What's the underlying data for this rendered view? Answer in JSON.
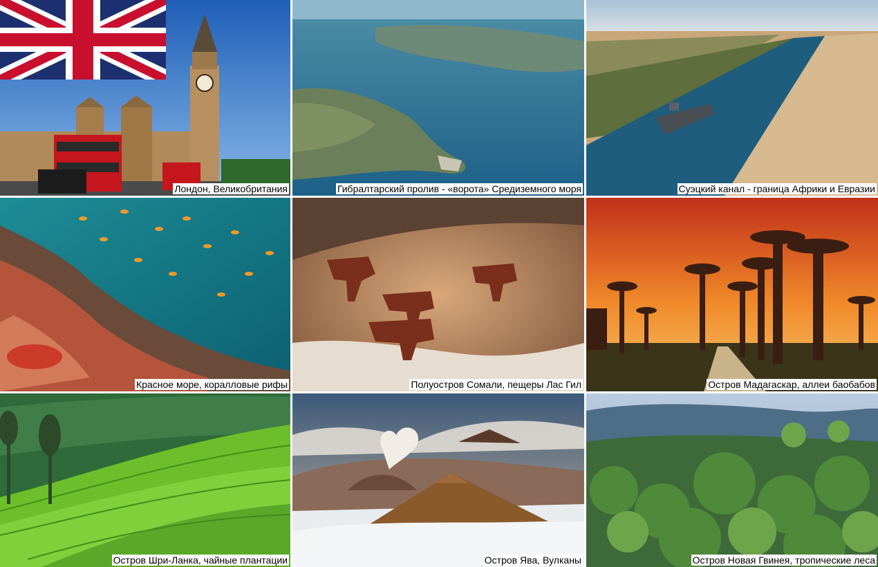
{
  "tiles": [
    {
      "caption": "Лондон, Великобритания",
      "scene": "big-ben-london"
    },
    {
      "caption": "Гибралтарский пролив - «ворота» Средиземного моря",
      "scene": "strait-of-gibraltar-aerial"
    },
    {
      "caption": "Суэцкий канал - граница Африки и Евразии",
      "scene": "suez-canal-ship"
    },
    {
      "caption": "Красное море, коралловые рифы",
      "scene": "coral-reef-fish"
    },
    {
      "caption": "Полуостров Сомали, пещеры Лас Гил",
      "scene": "cave-paintings"
    },
    {
      "caption": "Остров Мадагаскар, аллеи баобабов",
      "scene": "baobab-avenue-sunset"
    },
    {
      "caption": "Остров Шри-Ланка, чайные плантации",
      "scene": "tea-plantation-hills"
    },
    {
      "caption": "Остров Ява, Вулканы",
      "scene": "bromo-volcanoes"
    },
    {
      "caption": "Остров Новая Гвинея, тропические леса",
      "scene": "tropical-rainforest"
    }
  ]
}
